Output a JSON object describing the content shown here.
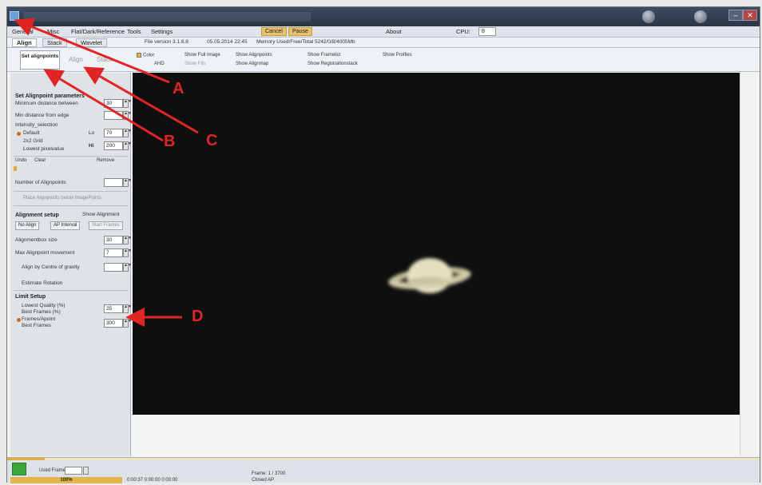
{
  "titlebar": {
    "title": "",
    "minimize_glyph": "–",
    "close_glyph": "✕"
  },
  "menubar": {
    "items": [
      "General",
      "Misc",
      "Flat/Dark/Reference",
      "Tools",
      "Settings"
    ],
    "cancel_label": "Cancel",
    "pause_label": "Pause",
    "about_label": "About",
    "cpu_label": "CPU:",
    "cpu_value": "8"
  },
  "tabs": {
    "align_label": "Align",
    "stack_label": "Stack",
    "wavelet_label": "Wavelet",
    "file_version": "File version 3.1.6.8",
    "file_date": "05.05.2014 22:45",
    "memory_info": "Memory Used/Free/Total  5242/0/8/4005Mb"
  },
  "ribbon": {
    "set_alignpoints_label": "Set alignpoints",
    "align_label": "Align",
    "stack_dim_label": "Stack",
    "color_label": "Color",
    "ahd_label": "AHD",
    "show_full_image_label": "Show Full Image",
    "show_fits_label": "Show Fits",
    "show_alignpoints_label": "Show Alignpoints",
    "show_alignmap_label": "Show Alignmap",
    "show_framelist_label": "Show Framelist",
    "show_registrationstack_label": "Show Registrationstack",
    "show_profiles_label": "Show Profiles"
  },
  "left_panel": {
    "set_ap_title": "Set Alignpoint parameters",
    "min_distance_label": "Minimum distance between",
    "min_distance_value": "30",
    "min_edge_label": "Min distance from edge",
    "min_edge_value": "",
    "intensity_label": "Intensity_selection",
    "default_label": "Default",
    "default_sub": "Lo",
    "default_value": "70",
    "option_2x2": "2x2 Grid",
    "lowest_label": "Lowest pixelvalue",
    "lowest_sub": "Hi",
    "lowest_value": "200",
    "undo_label": "Undo",
    "clear_label": "Clear",
    "remove_label": "Remove",
    "num_alignpoints_label": "Number of Alignpoints",
    "num_alignpoints_value": "",
    "place_label": "Place Alignpoints below ImagePoints",
    "alignment_setup_title": "Alignment setup",
    "show_alignment_label": "Show Alignment",
    "no_align_label": "No Align",
    "ap_interval_label": "AP Interval",
    "start_frames_label": "Start Frames",
    "alignbox_size_label": "Alignmentbox size",
    "alignbox_size_value": "30",
    "max_movement_label": "Max Alignpoint movement",
    "max_movement_value": "7",
    "align_gravity_label": "Align by Centre of gravity",
    "align_gravity_value": "",
    "estimate_rotation_label": "Estimate Rotation",
    "limit_setup_title": "Limit Setup",
    "lowest_quality_label": "Lowest Quality (%)",
    "lowest_quality_value": "25",
    "best_frames_pct_label": "Best Frames (%)",
    "frames_apoint_label": "Frames/Apoint",
    "frames_apoint_value": "300",
    "best_frames_label": "Best Frames"
  },
  "statusbar": {
    "progress": 0.05,
    "used_frame_label": "Used Frame",
    "used_frame_value": "",
    "progress_label": "100%",
    "timing_text": "0:00:37  0:00:00  0:00:00",
    "frame_text": "Frame: 1 / 3700",
    "status_text": "Closed AP"
  },
  "callouts": [
    "A",
    "B",
    "C",
    "D"
  ],
  "colors": {
    "callout_red": "#e02525",
    "accent_orange": "#e2ad3f",
    "viewer_bg": "#0f0f0f",
    "indicator_green": "#3aa83e"
  }
}
